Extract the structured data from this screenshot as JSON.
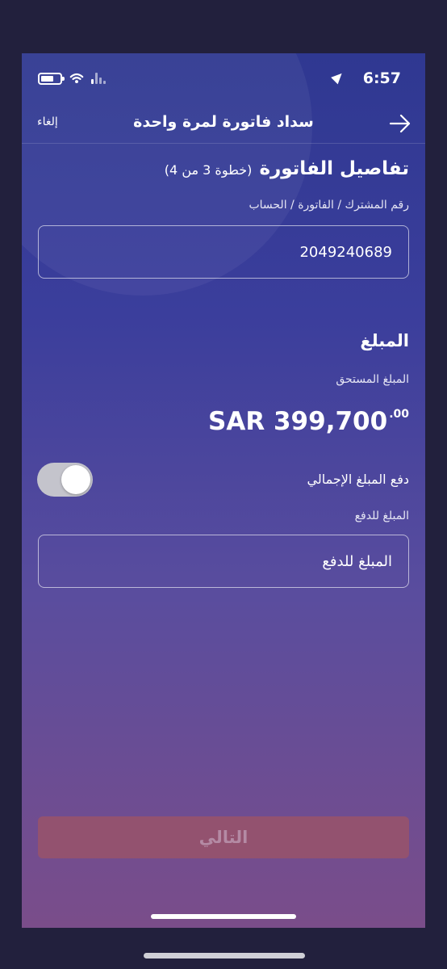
{
  "status_bar": {
    "time": "6:57"
  },
  "nav": {
    "title": "سداد فاتورة لمرة واحدة",
    "cancel_label": "إلغاء"
  },
  "bill_details": {
    "title": "تفاصيل الفاتورة",
    "step": "(خطوة 3 من 4)",
    "subscriber_label": "رقم المشترك / الفاتورة / الحساب",
    "subscriber_value": "2049240689"
  },
  "amount": {
    "heading": "المبلغ",
    "due_label": "المبلغ المستحق",
    "due_value": "SAR 399,700",
    "due_decimals": ".00",
    "pay_total_label": "دفع المبلغ الإجمالي",
    "pay_total_enabled": true,
    "pay_amount_label": "المبلغ للدفع",
    "pay_amount_placeholder": "المبلغ للدفع"
  },
  "footer": {
    "next_label": "التالي"
  },
  "colors": {
    "gradient_top": "#2f3891",
    "gradient_bottom": "#7a4d8a",
    "next_button_bg": "#93526f"
  }
}
